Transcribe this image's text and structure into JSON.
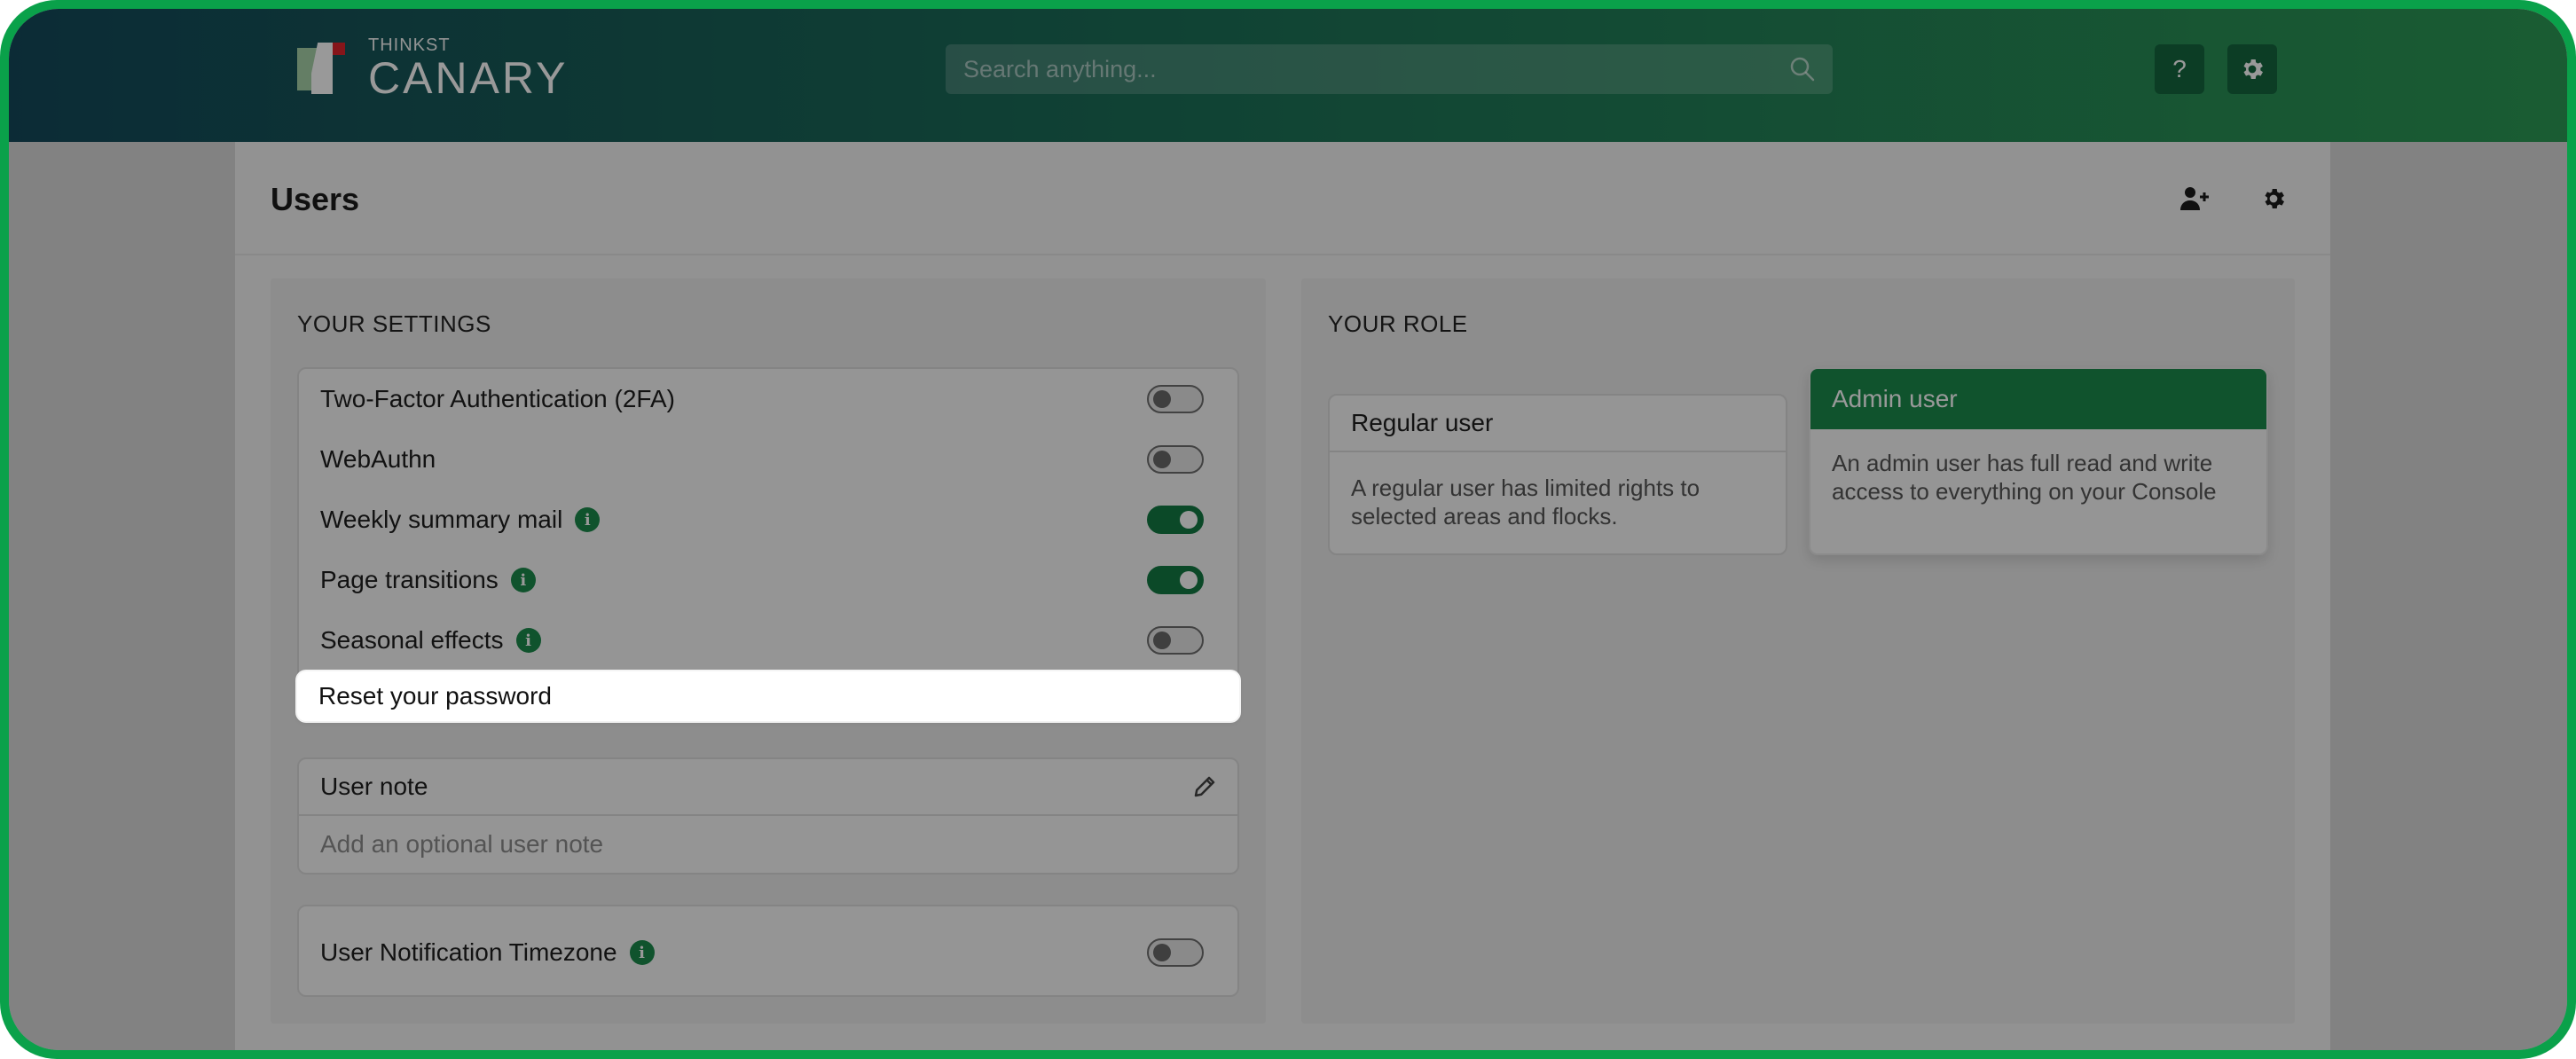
{
  "header": {
    "logo_small": "THINKST",
    "logo_big": "CANARY",
    "search_placeholder": "Search anything...",
    "help_label": "?"
  },
  "page": {
    "title": "Users"
  },
  "settings": {
    "heading": "YOUR SETTINGS",
    "rows": [
      {
        "label": "Two-Factor Authentication (2FA)",
        "on": false,
        "info": false
      },
      {
        "label": "WebAuthn",
        "on": false,
        "info": false
      },
      {
        "label": "Weekly summary mail",
        "on": true,
        "info": true
      },
      {
        "label": "Page transitions",
        "on": true,
        "info": true
      },
      {
        "label": "Seasonal effects",
        "on": false,
        "info": true
      }
    ],
    "reset_password": "Reset your password",
    "user_note": {
      "title": "User note",
      "placeholder": "Add an optional user note"
    },
    "timezone": {
      "label": "User Notification Timezone",
      "on": false
    },
    "info_glyph": "i"
  },
  "role": {
    "heading": "YOUR ROLE",
    "regular": {
      "title": "Regular user",
      "description": "A regular user has limited rights to selected areas and flocks."
    },
    "admin": {
      "title": "Admin user",
      "description": "An admin user has full read and write access to everything on your Console"
    }
  },
  "colors": {
    "brand_green": "#1b8a4c",
    "frame_green": "#0aa14a",
    "header_start": "#14495a",
    "header_end": "#2c9a56"
  }
}
